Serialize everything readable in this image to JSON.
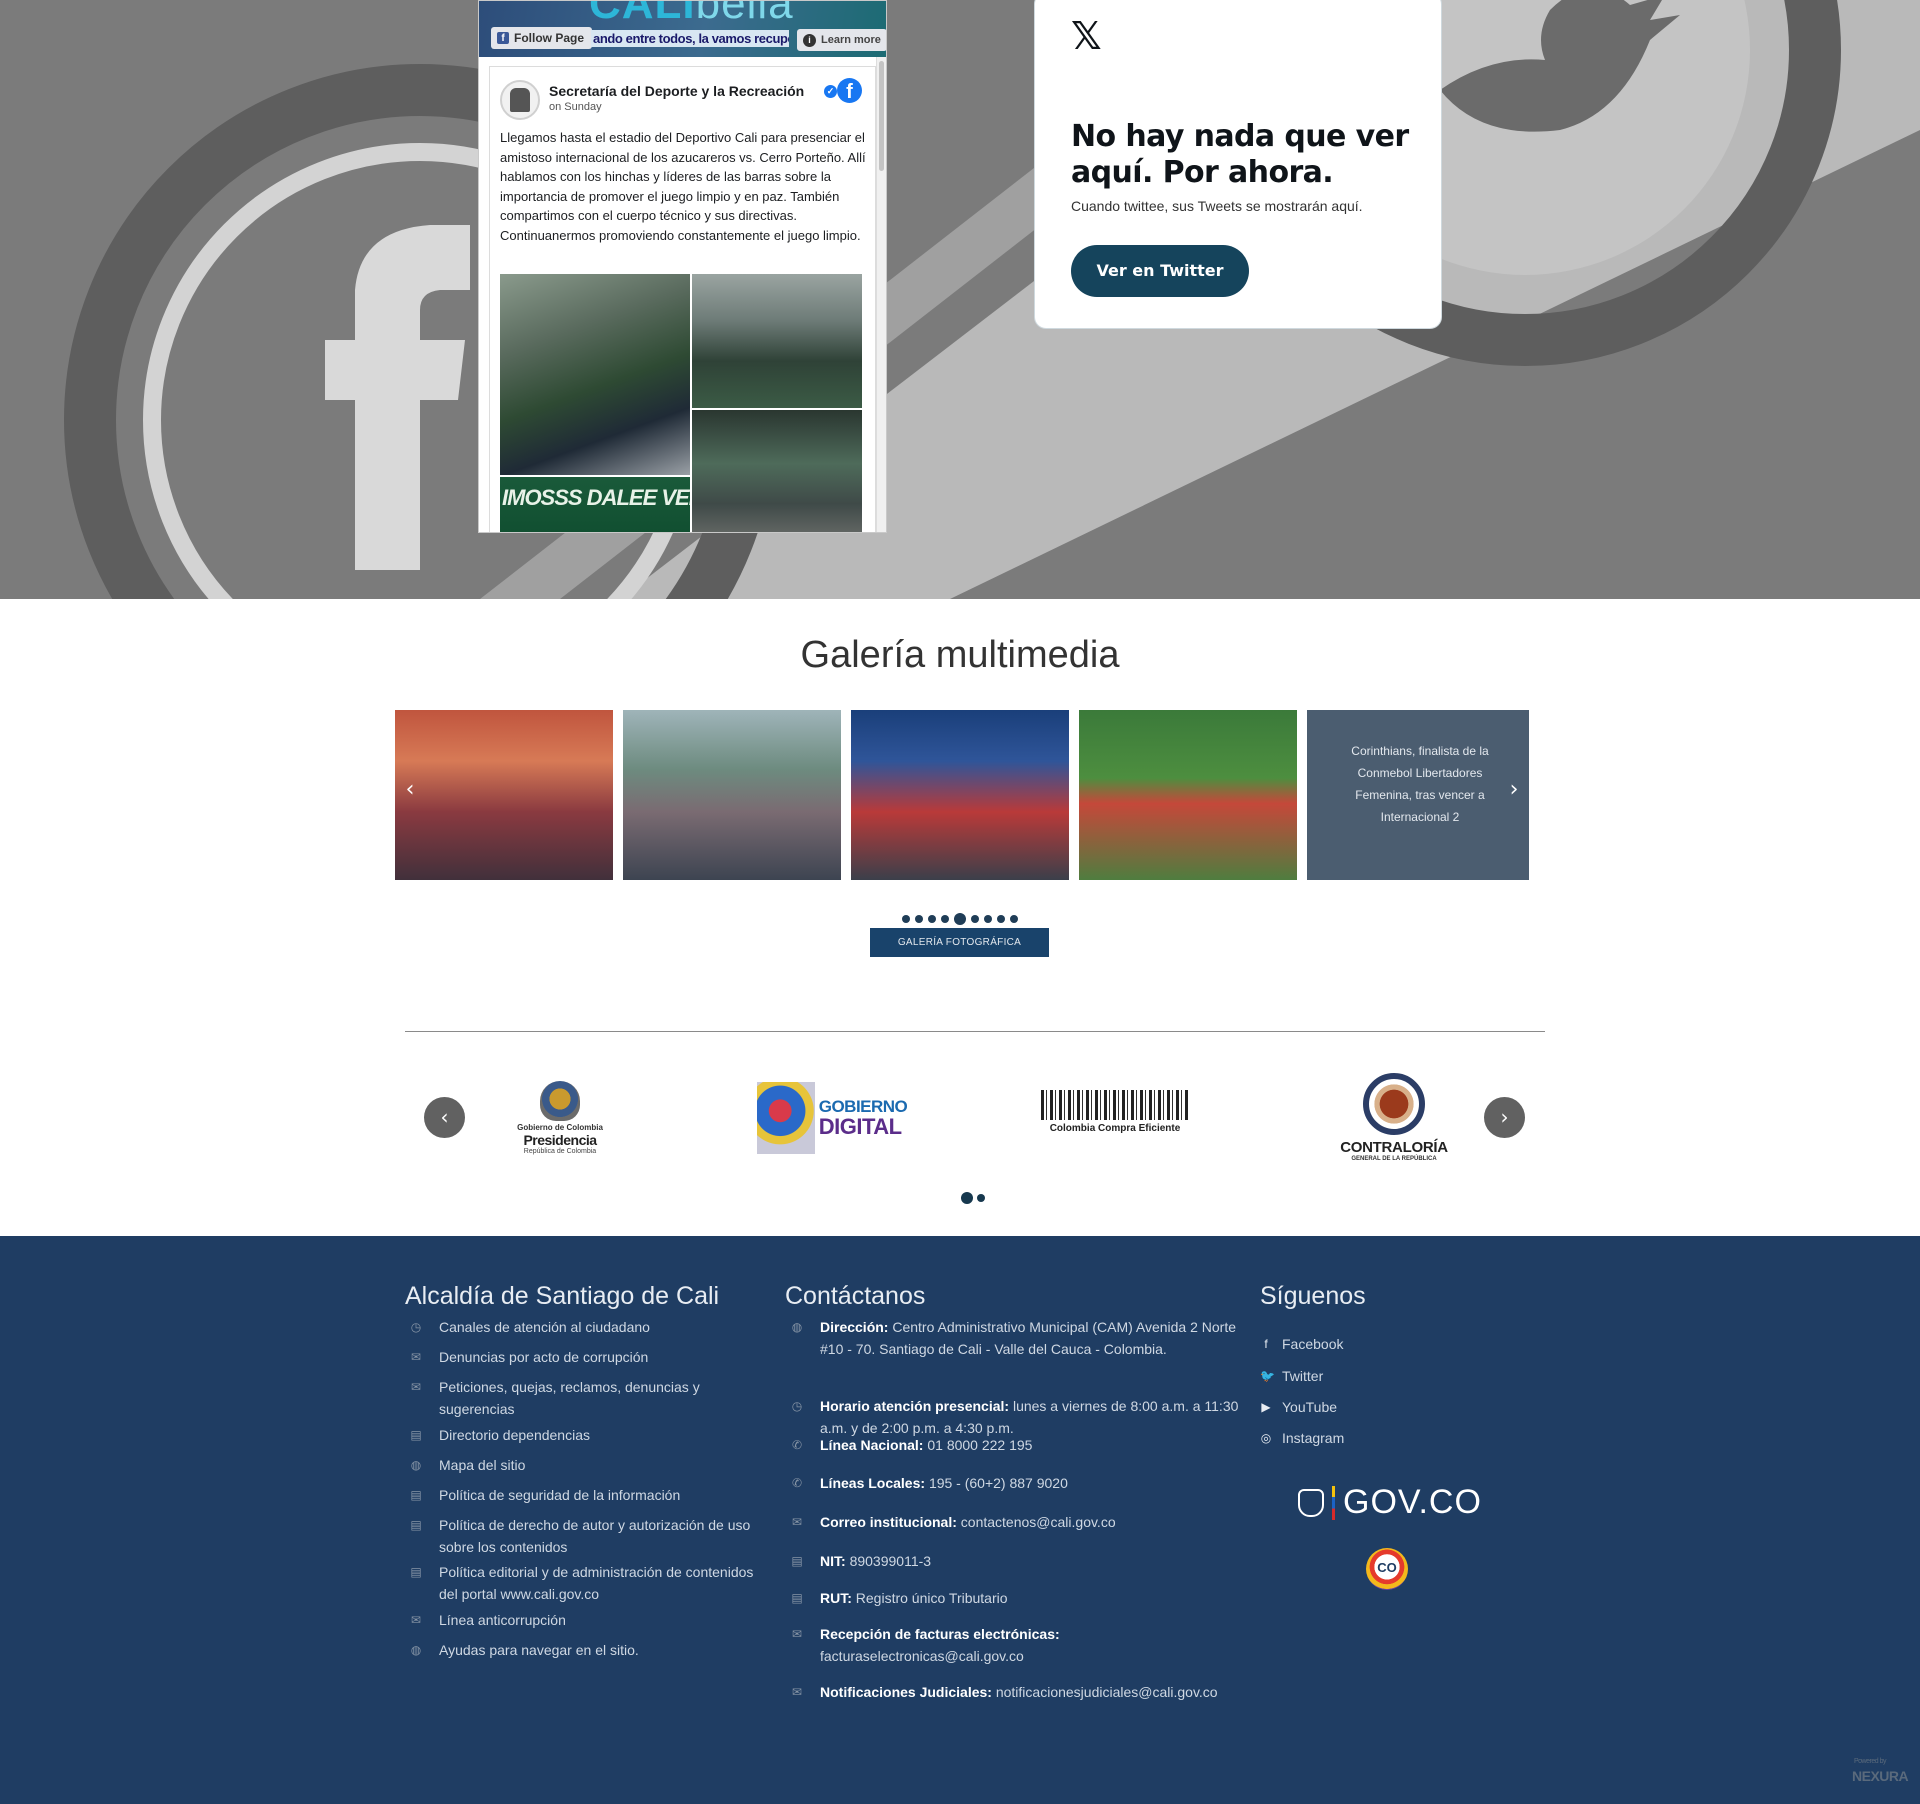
{
  "social": {
    "facebook": {
      "cover_logo": "CALI",
      "cover_logo_suffix": "bella",
      "follow_label": "Follow Page",
      "tagline": "ando entre todos, la vamos recuperar",
      "learn_more_label": "Learn more",
      "page_name": "Secretaría del Deporte y la Recreación",
      "post_time": "on Sunday",
      "post_text": "Llegamos hasta el estadio del Deportivo Cali para presenciar el amistoso internacional de los azucareros vs. Cerro Porteño. Allí hablamos con los hinchas y líderes de las barras sobre la importancia de promover el juego limpio y en paz. También compartimos con el cuerpo técnico y sus directivas. Continuanermos promoviendo constantemente el juego limpio.",
      "photo_banner_text": "IMOSSS DALEE VERDE!"
    },
    "twitter": {
      "logo": "𝕏",
      "title": "No hay nada que ver aquí. Por ahora.",
      "subtitle": "Cuando twittee, sus Tweets se mostrarán aquí.",
      "button_label": "Ver en Twitter"
    }
  },
  "gallery": {
    "title": "Galería multimedia",
    "caption": "Corinthians, finalista de la Conmebol Libertadores Femenina, tras vencer a Internacional 2",
    "prev_icon": "‹",
    "next_icon": "›",
    "dots_count": 9,
    "active_dot": 4,
    "button_label": "GALERÍA FOTOGRÁFICA"
  },
  "logos": {
    "items": [
      {
        "t1": "Gobierno de Colombia",
        "t2": "Presidencia",
        "t3": "República de Colombia"
      },
      {
        "t1": "GOBIERNO",
        "t2": "DIGITAL"
      },
      {
        "t1": "Colombia Compra Eficiente"
      },
      {
        "t1": "CONTRALORÍA",
        "t2": "GENERAL DE LA REPÚBLICA"
      }
    ],
    "prev_icon": "‹",
    "next_icon": "›"
  },
  "footer": {
    "col1_title": "Alcaldía de Santiago de Cali",
    "col1_links": [
      "Canales de atención al ciudadano",
      "Denuncias por acto de corrupción",
      "Peticiones, quejas, reclamos, denuncias y sugerencias",
      "Directorio dependencias",
      "Mapa del sitio",
      "Política de seguridad de la información",
      "Política de derecho de autor y autorización de uso sobre los contenidos",
      "Política editorial y de administración de contenidos del portal www.cali.gov.co",
      "Línea anticorrupción",
      "Ayudas para navegar en el sitio."
    ],
    "col2_title": "Contáctanos",
    "contacts": [
      {
        "label": "Dirección:",
        "value": "Centro Administrativo Municipal (CAM) Avenida 2 Norte #10 - 70. Santiago de Cali - Valle del Cauca - Colombia."
      },
      {
        "label": "Horario atención presencial:",
        "value": "lunes a viernes de 8:00 a.m. a 11:30 a.m. y de 2:00 p.m. a 4:30 p.m."
      },
      {
        "label": "Línea Nacional:",
        "value": "01 8000 222 195"
      },
      {
        "label": "Líneas Locales:",
        "value": "195 - (60+2) 887 9020"
      },
      {
        "label": "Correo institucional:",
        "value": "contactenos@cali.gov.co"
      },
      {
        "label": "NIT:",
        "value": "890399011-3"
      },
      {
        "label": "RUT:",
        "value": "Registro único Tributario"
      },
      {
        "label": "Recepción de facturas electrónicas:",
        "value": "facturaselectronicas@cali.gov.co"
      },
      {
        "label": "Notificaciones Judiciales:",
        "value": "notificacionesjudiciales@cali.gov.co"
      }
    ],
    "col3_title": "Síguenos",
    "social": [
      "Facebook",
      "Twitter",
      "YouTube",
      "Instagram"
    ],
    "govco": "GOV.CO",
    "co_badge": "CO",
    "powered_by": "Powered by",
    "nexura": "NEXURA"
  }
}
